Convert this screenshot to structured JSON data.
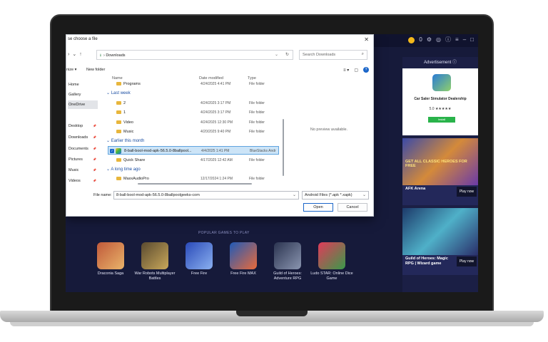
{
  "bluestacks": {
    "coins": "0",
    "advertisement": "Advertisement ⓘ",
    "ad": {
      "name": "Car Saler Simulator Dealership",
      "rating": "5.0 ★★★★★",
      "install": "Install"
    },
    "side_games": [
      {
        "title": "AFK Arena",
        "play": "Play now",
        "banner": "GET ALL CLASSIC HEROES FOR FREE"
      },
      {
        "title": "Guild of Heroes: Magic RPG | Wizard game",
        "play": "Play now",
        "banner": ""
      }
    ],
    "popular_label": "POPULAR GAMES TO PLAY",
    "games": [
      {
        "name": "Draconia Saga",
        "color": "#c0593a"
      },
      {
        "name": "War Robots Multiplayer Battles",
        "color": "#7a6a45"
      },
      {
        "name": "Free Fire",
        "color": "#3a6ac8"
      },
      {
        "name": "Free Fire MAX",
        "color": "#2f74c9"
      },
      {
        "name": "Guild of Heroes: Adventure RPG",
        "color": "#3b4a6a"
      },
      {
        "name": "Ludo STAR: Online Dice Game",
        "color": "#c23a6a"
      }
    ]
  },
  "dialog": {
    "title": "se choose a file",
    "address": "Downloads",
    "search_placeholder": "Search Downloads",
    "organize": "nize ▾",
    "new_folder": "New folder",
    "nav": [
      "Home",
      "Gallery",
      "OneDrive",
      "Desktop",
      "Downloads",
      "Documents",
      "Pictures",
      "Music",
      "Videos"
    ],
    "columns": {
      "name": "Name",
      "date": "Date modified",
      "type": "Type"
    },
    "partial_row": {
      "name": "Programs",
      "date": "4/24/2025 4:41 PM",
      "type": "File folder"
    },
    "sections": {
      "last_week": "Last week",
      "earlier": "Earlier this month",
      "long_ago": "A long time ago"
    },
    "rows": [
      {
        "name": "2",
        "date": "4/24/2025 3:17 PM",
        "type": "File folder"
      },
      {
        "name": "1",
        "date": "4/24/2025 3:17 PM",
        "type": "File folder"
      },
      {
        "name": "Video",
        "date": "4/24/2025 12:30 PM",
        "type": "File folder"
      },
      {
        "name": "Music",
        "date": "4/20/2025 9:40 PM",
        "type": "File folder"
      }
    ],
    "selected": {
      "name": "8-ball-bool-mod-apk-56.5.0-8ballpool...",
      "date": "4/4/2025 1:41 PM",
      "type": "BlueStacks Andr"
    },
    "quick_share": {
      "name": "Quick Share",
      "date": "4/17/2025 12:42 AM",
      "type": "File folder"
    },
    "maxx": {
      "name": "MaxxAudioPro",
      "date": "12/17/2024 1:24 PM",
      "type": "File folder"
    },
    "preview": "No preview available.",
    "file_name_label": "File name:",
    "file_name": "8-ball-bool-mod-apk-56.5.0-8ballpoolgeeks-com",
    "file_type": "Android Files (*.apk *.xapk)",
    "open": "Open",
    "cancel": "Cancel"
  }
}
